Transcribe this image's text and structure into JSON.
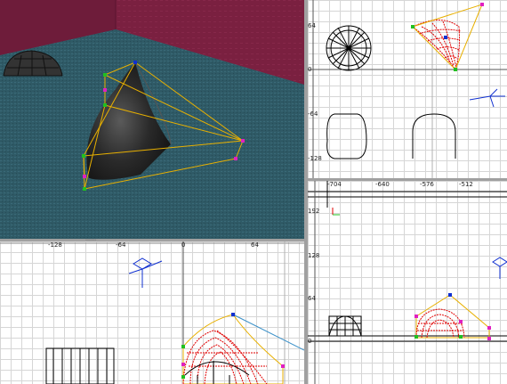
{
  "views": {
    "perspective": {
      "name": "3d-perspective-view"
    },
    "top_right": {
      "labels": {
        "y64": "64",
        "y0": "0",
        "yn64": "-64",
        "yn128": "-128"
      }
    },
    "bottom_left": {
      "labels": {
        "xn128": "-128",
        "xn64": "-64",
        "x0": "0",
        "x64": "64"
      }
    },
    "bottom_right": {
      "labels": {
        "xn704": "-704",
        "xn640": "-640",
        "xn576": "-576",
        "xn512": "-512",
        "y192": "192",
        "y128": "128",
        "y64": "64",
        "y0": "0"
      }
    }
  },
  "colors": {
    "wall": "#7a2040",
    "floor": "#2f5a66",
    "control_cage": "#e8b000",
    "patch_mesh": "#e00000",
    "vertex_green": "#20c020",
    "vertex_magenta": "#e020c0",
    "vertex_blue": "#1030d0",
    "grid_major": "#d6d6d6"
  },
  "icons": [
    "camera-icon",
    "axis-gizmo-icon"
  ]
}
